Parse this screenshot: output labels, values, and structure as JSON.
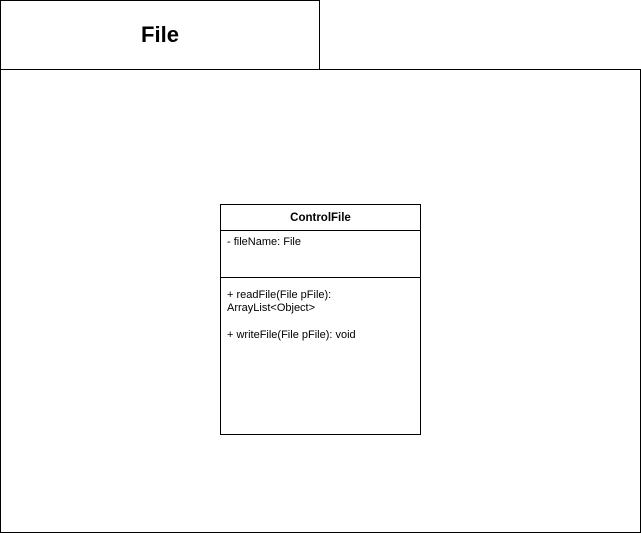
{
  "package": {
    "title": "File"
  },
  "class": {
    "name": "ControlFile",
    "attributes": [
      "- fileName: File"
    ],
    "operations": [
      "+ readFile(File pFile):\nArrayList<Object>",
      "+ writeFile(File pFile): void"
    ]
  }
}
